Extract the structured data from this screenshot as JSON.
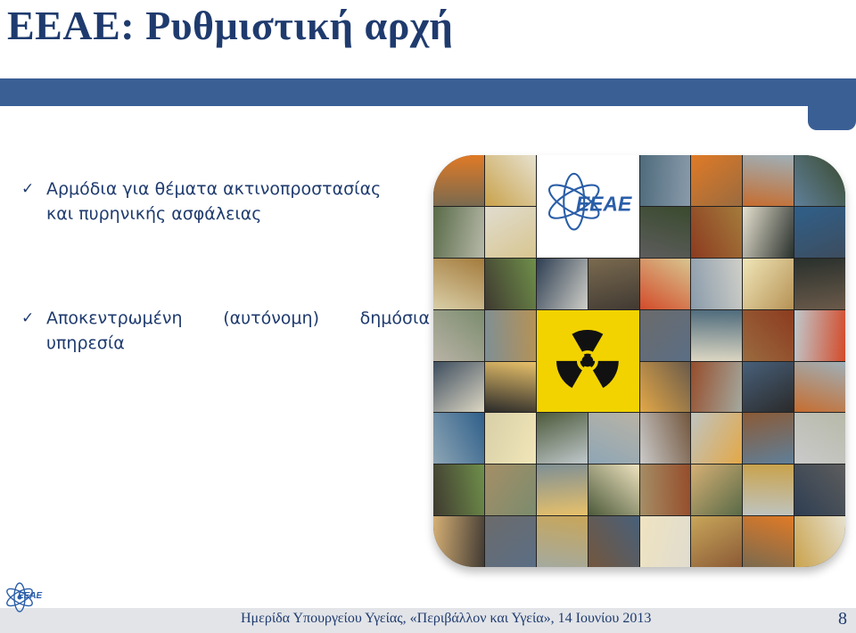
{
  "slide": {
    "title": "ΕΕΑΕ: Ρυθμιστική αρχή",
    "bullets": [
      {
        "line1": "Αρμόδια για θέματα ακτινοπροστασίας",
        "line2": "και πυρηνικής ασφάλειας"
      },
      {
        "line1_words": [
          "Αποκεντρωμένη",
          "(αυτόνομη)",
          "δημόσια"
        ],
        "line2": "υπηρεσία"
      }
    ],
    "bullet_icon": "check-mark-icon"
  },
  "collage": {
    "logo_text": "EEAE",
    "icons": [
      "atom-logo-icon",
      "radiation-hazard-icon"
    ],
    "colors": [
      "#7a6a4f",
      "#c9a24b",
      "#4e6b7c",
      "#e07a26",
      "#9fb0b8",
      "#3a4a2e",
      "#b7b9a9",
      "#d8c690",
      "#5d5d5d",
      "#8c3b1f",
      "#e6e1cf",
      "#2f5f8a",
      "#a47b3c",
      "#6f8f4a",
      "#cfcfc8",
      "#413a33",
      "#d34b2a",
      "#8a9bab",
      "#f0e6b8",
      "#29302c",
      "#7b8c6e",
      "#b69255",
      "#5b6e85",
      "#ddd7c3",
      "#9a6b3f",
      "#c0c8cc",
      "#3d4d5e",
      "#e8c16a",
      "#6a5a4a",
      "#a4aaa0",
      "#2a2a2a",
      "#c66d2f",
      "#8ea6b5",
      "#d9cfa8",
      "#4c5a3a",
      "#b9b3a6",
      "#73563d",
      "#e3a847",
      "#5f7f99",
      "#cacaca",
      "#3f3a30",
      "#a58e66",
      "#7e8f95",
      "#efe3c0",
      "#964d2b",
      "#586a47",
      "#bfc4c0",
      "#2e3e52",
      "#d6b075",
      "#6b6b6b",
      "#c8a65a",
      "#48607a",
      "#e0dccf",
      "#8b5a36"
    ]
  },
  "footer": {
    "text": "Ημερίδα Υπουργείου Υγείας, «Περιβάλλον και Υγεία», 14 Ιουνίου 2013",
    "page_number": "8",
    "logo_text": "EEAE"
  }
}
